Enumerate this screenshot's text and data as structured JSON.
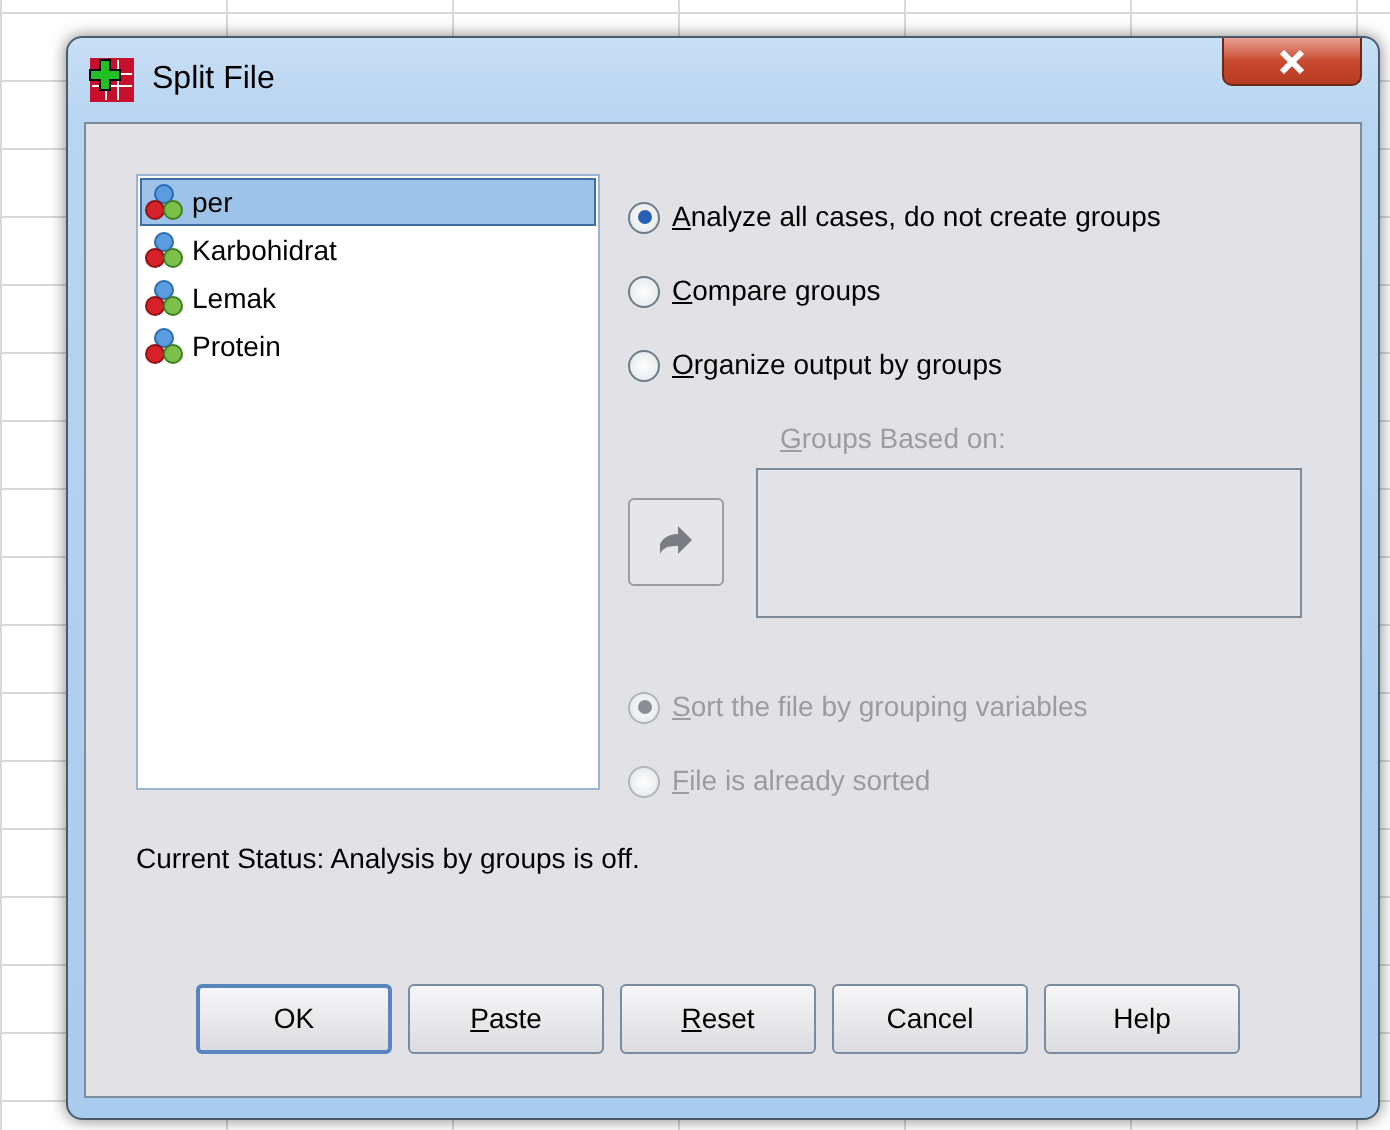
{
  "window": {
    "title": "Split File"
  },
  "variables": [
    {
      "name": "per",
      "selected": true
    },
    {
      "name": "Karbohidrat",
      "selected": false
    },
    {
      "name": "Lemak",
      "selected": false
    },
    {
      "name": "Protein",
      "selected": false
    }
  ],
  "mode_options": [
    {
      "label": "Analyze all cases, do not create groups",
      "mnemonic": true,
      "selected": true,
      "disabled": false
    },
    {
      "label": "Compare groups",
      "mnemonic": true,
      "selected": false,
      "disabled": false
    },
    {
      "label": "Organize output by groups",
      "mnemonic": true,
      "selected": false,
      "disabled": false
    }
  ],
  "groups_based_on": {
    "label": "Groups Based on:",
    "mnemonic": true,
    "disabled": true
  },
  "move_button": {
    "disabled": true
  },
  "sort_options": [
    {
      "label": "Sort the file by grouping variables",
      "mnemonic": true,
      "selected": true,
      "disabled": true
    },
    {
      "label": "File is already sorted",
      "mnemonic": true,
      "selected": false,
      "disabled": true
    }
  ],
  "status": "Current Status: Analysis by groups is off.",
  "buttons": [
    {
      "label": "OK",
      "mnemonic": false,
      "default": true
    },
    {
      "label": "Paste",
      "mnemonic": true,
      "default": false
    },
    {
      "label": "Reset",
      "mnemonic": true,
      "default": false
    },
    {
      "label": "Cancel",
      "mnemonic": false,
      "default": false
    },
    {
      "label": "Help",
      "mnemonic": false,
      "default": false
    }
  ]
}
